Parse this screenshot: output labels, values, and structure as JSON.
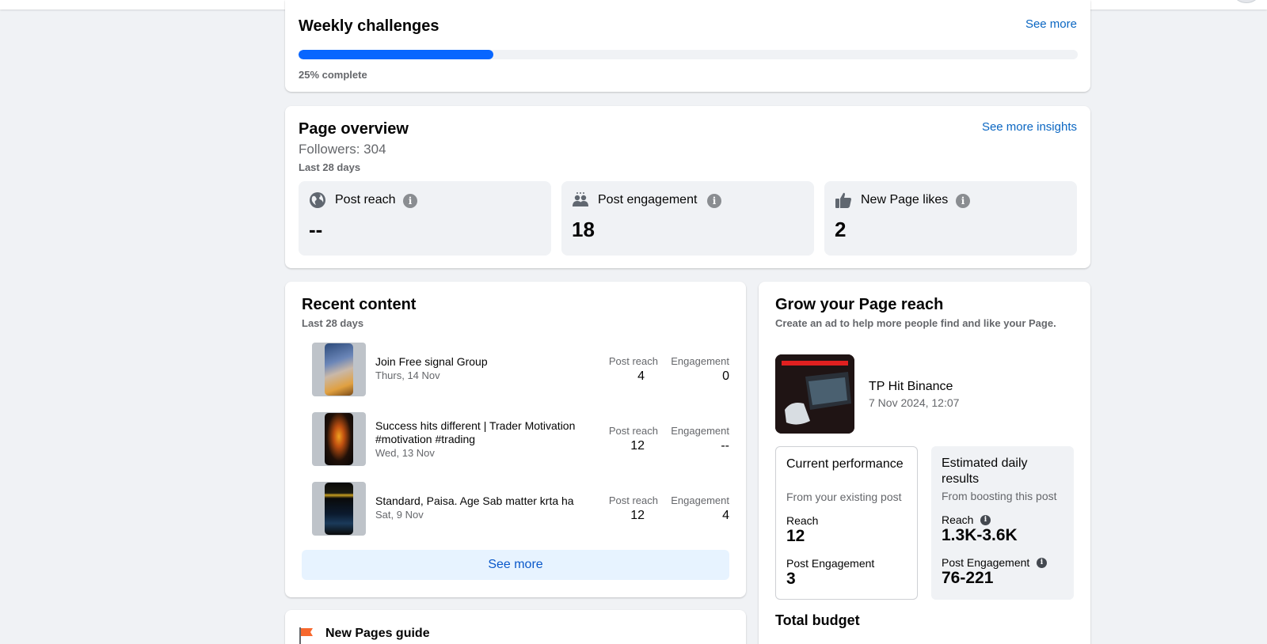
{
  "weekly": {
    "title": "Weekly challenges",
    "see_more": "See more",
    "progress_fraction": 0.25,
    "progress_text": "25% complete"
  },
  "overview": {
    "title": "Page overview",
    "see_more_insights": "See more insights",
    "followers": "Followers: 304",
    "period": "Last 28 days",
    "stats": [
      {
        "label": "Post reach",
        "value": "--",
        "icon": "globe-icon"
      },
      {
        "label": "Post engagement",
        "value": "18",
        "icon": "people-icon"
      },
      {
        "label": "New Page likes",
        "value": "2",
        "icon": "thumbs-up-icon"
      }
    ],
    "info_glyph": "i"
  },
  "recent": {
    "title": "Recent content",
    "period": "Last 28 days",
    "reach_header": "Post reach",
    "engagement_header": "Engagement",
    "items": [
      {
        "title": "Join Free signal Group",
        "date": "Thurs, 14 Nov",
        "reach": "4",
        "engagement": "0"
      },
      {
        "title": "Success hits different | Trader Motivation #motivation #trading",
        "date": "Wed, 13 Nov",
        "reach": "12",
        "engagement": "--"
      },
      {
        "title": "Standard, Paisa. Age Sab matter krta ha",
        "date": "Sat, 9 Nov",
        "reach": "12",
        "engagement": "4"
      }
    ],
    "see_more": "See more"
  },
  "guide": {
    "label": "New Pages guide",
    "icon": "flag-icon"
  },
  "grow": {
    "title": "Grow your Page reach",
    "description": "Create an ad to help more people find and like your Page.",
    "post": {
      "name": "TP Hit Binance",
      "date": "7 Nov 2024, 12:07"
    },
    "current": {
      "title": "Current performance",
      "subtitle": "From your existing post",
      "reach_label": "Reach",
      "reach_value": "12",
      "engagement_label": "Post Engagement",
      "engagement_value": "3"
    },
    "estimated": {
      "title": "Estimated daily results",
      "subtitle": "From boosting this post",
      "reach_label": "Reach",
      "reach_value": "1.3K-3.6K",
      "engagement_label": "Post Engagement",
      "engagement_value": "76-221"
    },
    "budget_title": "Total budget"
  },
  "colors": {
    "accent": "#0866ff",
    "link": "#0a66c2",
    "background": "#f0f2f5",
    "stat_bg": "#f0f2f5",
    "flag": "#f7682e"
  }
}
